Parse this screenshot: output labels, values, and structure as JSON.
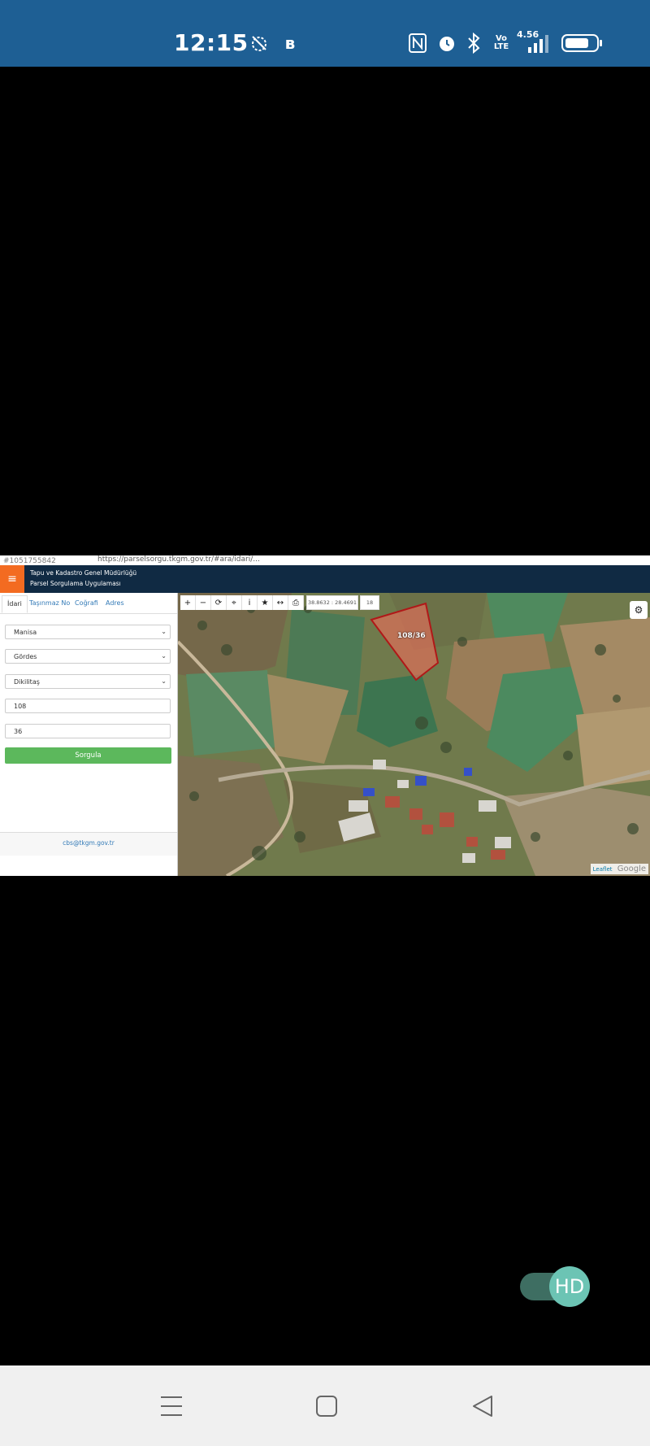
{
  "status_bar": {
    "time": "12:15",
    "network_speed": "4.56",
    "icons": [
      "alarm-off-icon",
      "b-icon",
      "nfc-icon",
      "alarm-icon",
      "bluetooth-icon",
      "volte-icon",
      "signal-icon",
      "battery-icon"
    ],
    "volte_text": "Vo LTE"
  },
  "browser": {
    "id_text": "#1051755842",
    "url": "https://parselsorgu.tkgm.gov.tr/#ara/idari/..."
  },
  "app": {
    "menu_icon": "hamburger-menu-icon",
    "title_line1": "Tapu ve Kadastro Genel Müdürlüğü",
    "title_line2": "Parsel Sorgulama Uygulaması"
  },
  "tabs": [
    {
      "label": "İdari",
      "active": true
    },
    {
      "label": "Taşınmaz No",
      "active": false
    },
    {
      "label": "Coğrafi",
      "active": false
    },
    {
      "label": "Adres",
      "active": false
    }
  ],
  "form": {
    "il": "Manisa",
    "ilce": "Gördes",
    "mahalle": "Dikilitaş",
    "ada": "108",
    "parsel": "36",
    "submit_label": "Sorgula"
  },
  "footer_email": "cbs@tkgm.gov.tr",
  "map": {
    "toolbar_icons": [
      "zoom-in-icon",
      "zoom-out-icon",
      "refresh-icon",
      "locate-icon",
      "info-icon",
      "star-icon",
      "measure-icon",
      "print-icon"
    ],
    "coordinates": "38.8632 : 28.4691",
    "zoom_level": "18",
    "parcel_label": "108/36",
    "attribution_leaflet": "Leaflet",
    "attribution_google": "Google"
  },
  "hd_toggle": {
    "label": "HD",
    "on": true
  },
  "nav_icons": [
    "menu-nav-icon",
    "home-nav-icon",
    "back-nav-icon"
  ]
}
